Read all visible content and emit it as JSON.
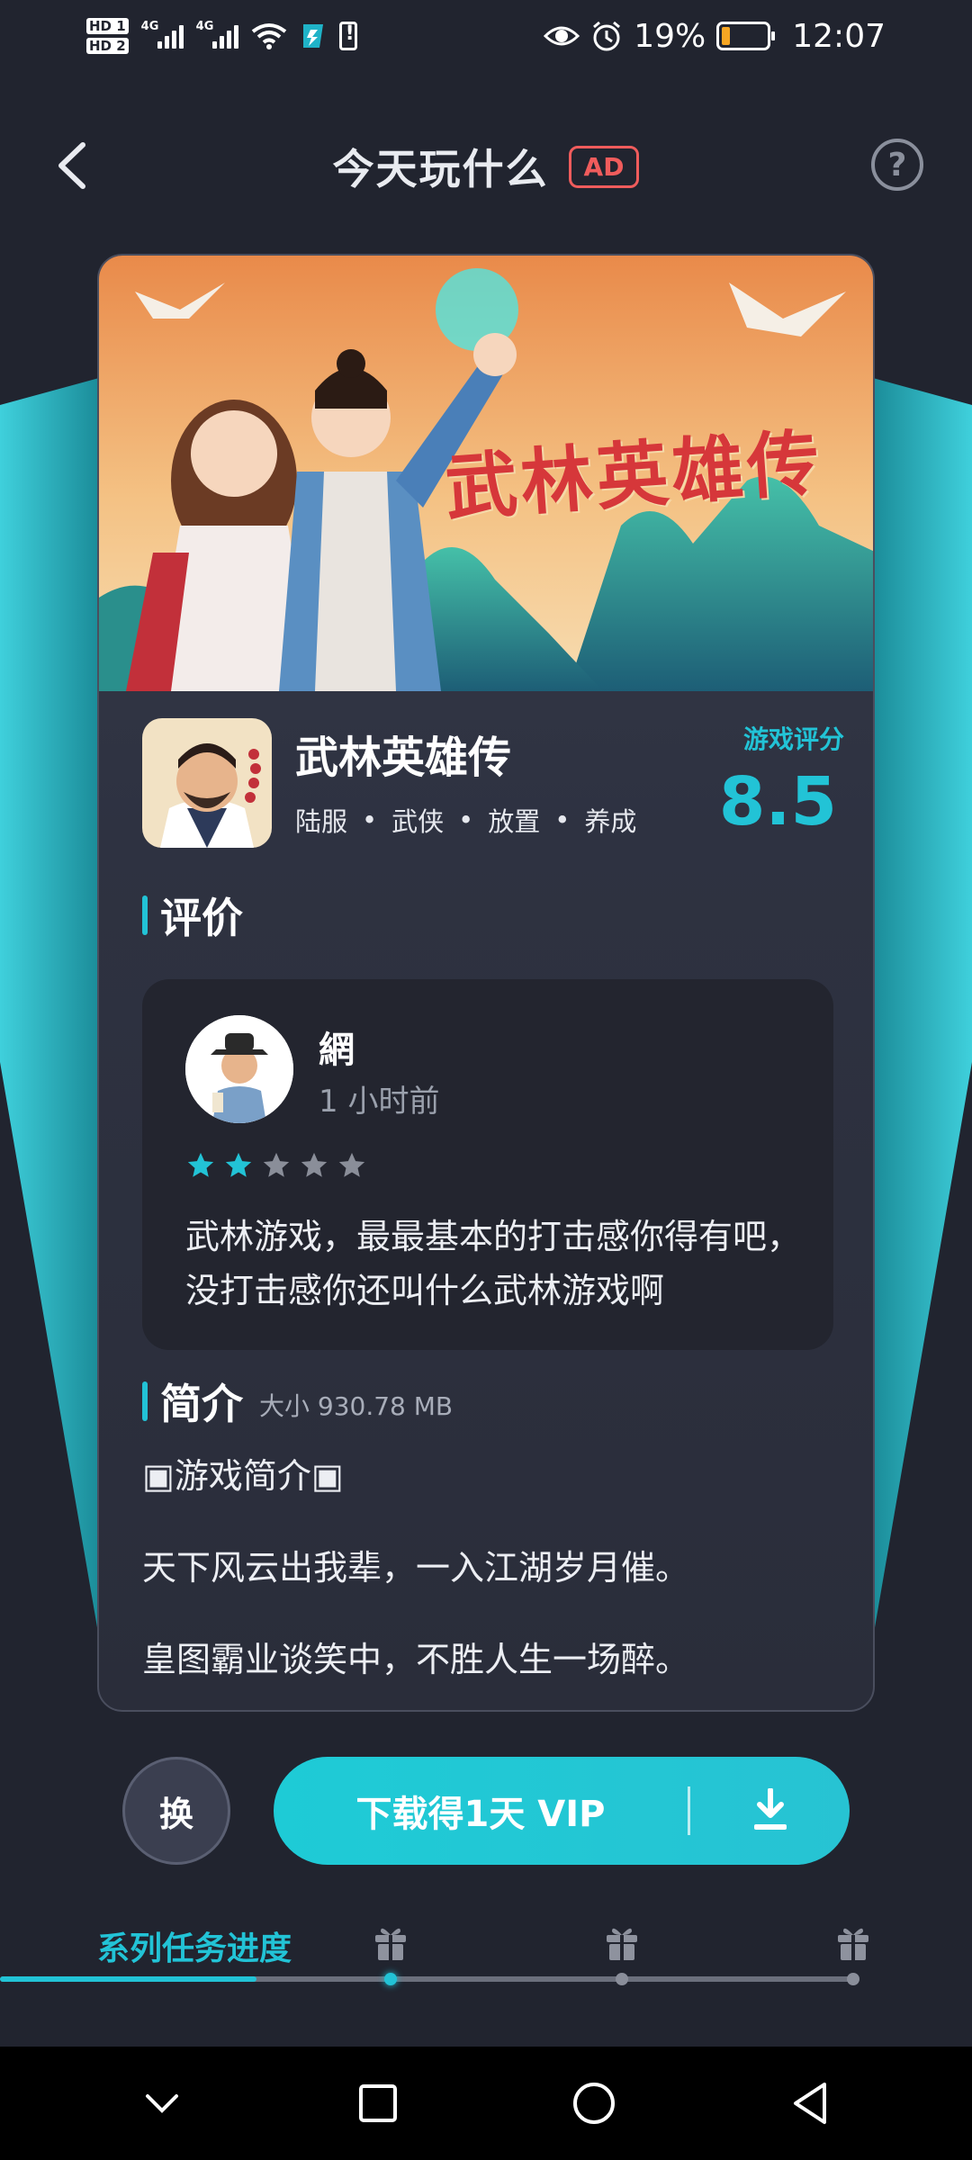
{
  "status_bar": {
    "hd1": "HD 1",
    "hd2": "HD 2",
    "net1": "4G",
    "net2": "4G",
    "battery_percent": "19%",
    "battery_level": 0.19,
    "time": "12:07"
  },
  "header": {
    "title": "今天玩什么",
    "ad_badge": "AD",
    "help_symbol": "?"
  },
  "game": {
    "name": "武林英雄传",
    "banner_title": "武林英雄传",
    "tags": [
      "陆服",
      "武侠",
      "放置",
      "养成"
    ],
    "tag_separator": "•",
    "score_label": "游戏评分",
    "score": "8.5"
  },
  "review_section": {
    "title": "评价",
    "reviewer": "網",
    "time": "1 小时前",
    "rating": 2,
    "rating_max": 5,
    "text": "武林游戏，最最基本的打击感你得有吧，没打击感你还叫什么武林游戏啊"
  },
  "intro_section": {
    "title": "简介",
    "size": "大小 930.78 MB",
    "lines": [
      "▣游戏简介▣",
      "天下风云出我辈，一入江湖岁月催。",
      "皇图霸业谈笑中，不胜人生一场醉。"
    ]
  },
  "actions": {
    "swap_label": "换",
    "download_label": "下载得1天 VIP"
  },
  "progress": {
    "label": "系列任务进度",
    "completed_fraction": 0.3,
    "milestones": 3
  },
  "colors": {
    "accent": "#22c3d6",
    "background": "#21242f",
    "ad_red": "#f05c5c",
    "battery_orange": "#f6a623"
  },
  "icons": {
    "back": "back-arrow-icon",
    "help": "help-icon",
    "star": "star-icon",
    "download": "download-icon",
    "gift": "gift-icon"
  }
}
